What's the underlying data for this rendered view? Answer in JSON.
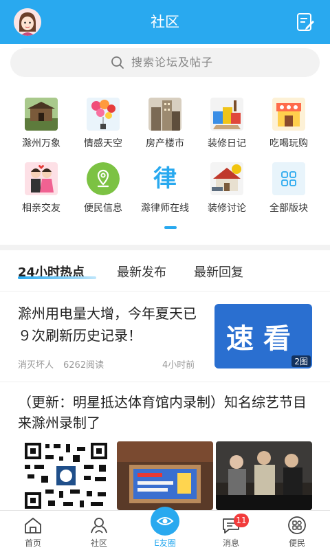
{
  "header": {
    "title": "社区"
  },
  "search": {
    "placeholder": "搜索论坛及帖子"
  },
  "grid": {
    "items": [
      {
        "label": "滁州万象",
        "icon": "city-gate-icon"
      },
      {
        "label": "情感天空",
        "icon": "balloons-icon"
      },
      {
        "label": "房产楼市",
        "icon": "buildings-icon"
      },
      {
        "label": "装修日记",
        "icon": "paint-cans-icon"
      },
      {
        "label": "吃喝玩购",
        "icon": "shopping-food-icon"
      },
      {
        "label": "相亲交友",
        "icon": "couple-icon"
      },
      {
        "label": "便民信息",
        "icon": "location-pin-icon"
      },
      {
        "label": "滁律师在线",
        "icon": "law-character-icon",
        "glyph": "律"
      },
      {
        "label": "装修讨论",
        "icon": "house-tools-icon"
      },
      {
        "label": "全部版块",
        "icon": "grid-icon"
      }
    ]
  },
  "tabs": [
    {
      "label": "24小时热点",
      "active": true
    },
    {
      "label": "最新发布",
      "active": false
    },
    {
      "label": "最新回复",
      "active": false
    }
  ],
  "posts": [
    {
      "title": "滁州用电量大增，今年夏天已９次刷新历史记录！",
      "author": "消灭坏人",
      "reads": "6262阅读",
      "time": "4小时前",
      "image_text": "速看",
      "image_count": "2图"
    },
    {
      "title": "（更新：明星抵达体育馆内录制）知名综艺节目来滁州录制了"
    }
  ],
  "bottom_nav": [
    {
      "label": "首页",
      "icon": "home-icon"
    },
    {
      "label": "社区",
      "icon": "community-icon"
    },
    {
      "label": "E友圈",
      "icon": "eye-circle-icon",
      "active": true
    },
    {
      "label": "消息",
      "icon": "message-icon",
      "badge": "11"
    },
    {
      "label": "便民",
      "icon": "services-grid-icon"
    }
  ],
  "colors": {
    "primary": "#29a9ef",
    "badge": "#f23b3b"
  }
}
